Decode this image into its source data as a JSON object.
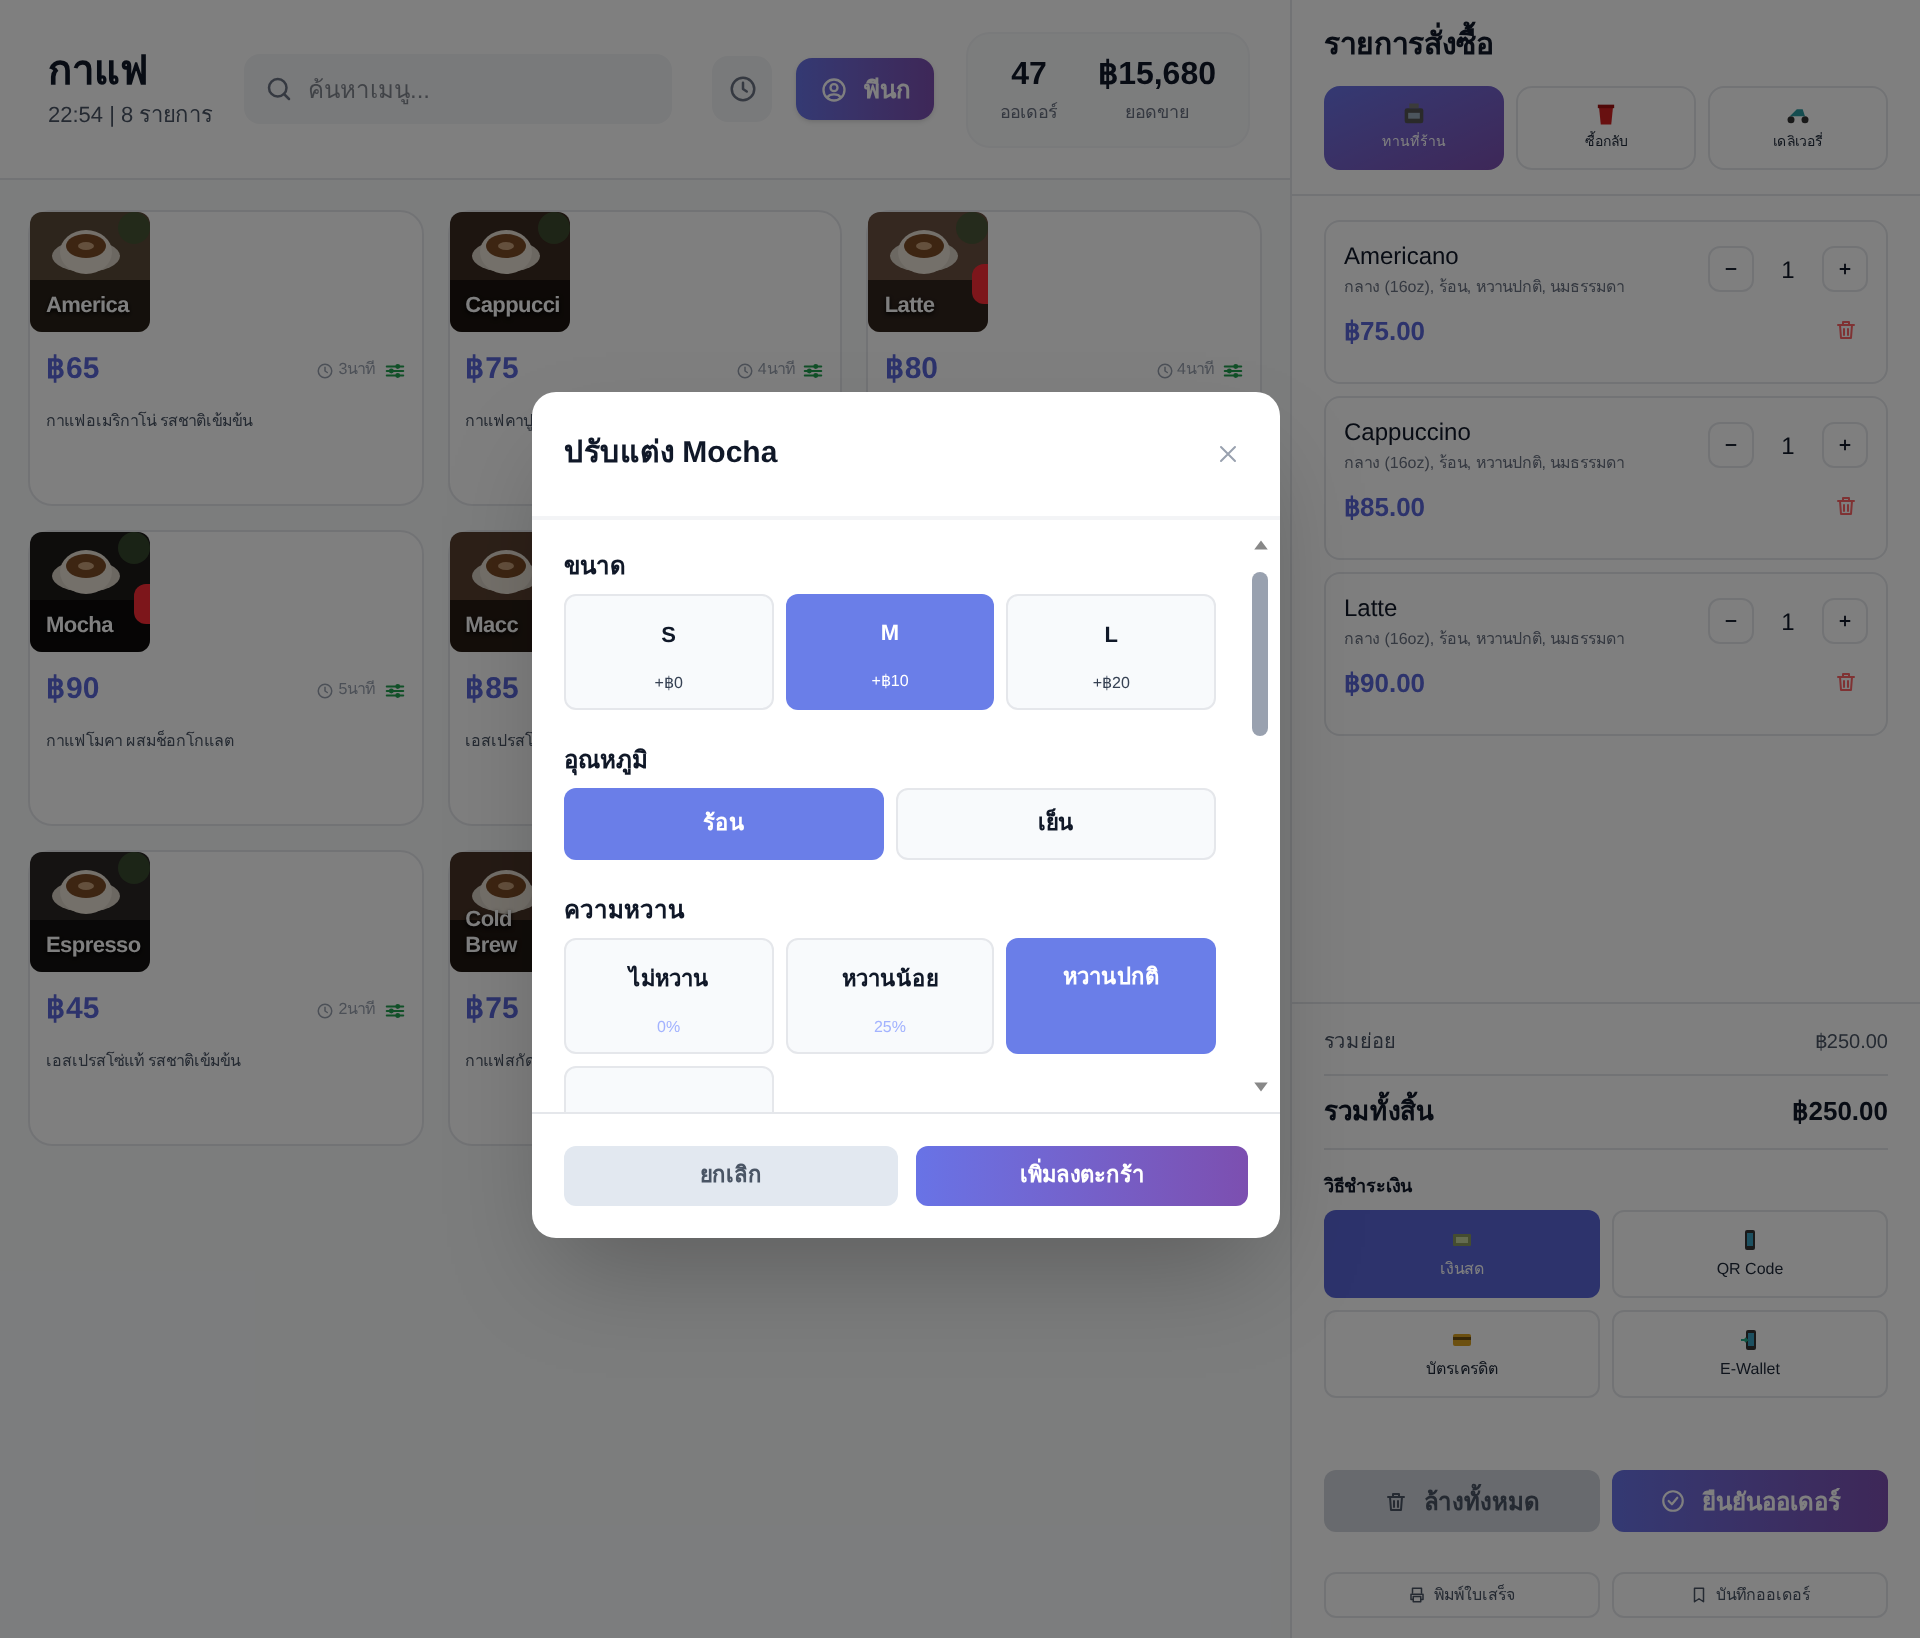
{
  "header": {
    "title": "กาแฟ",
    "subtitle": "22:54 | 8 รายการ",
    "search": {
      "placeholder": "ค้นหาเมนู..."
    },
    "staff": "พีนก",
    "stats": [
      {
        "value": "47",
        "label": "ออเดอร์"
      },
      {
        "value": "฿15,680",
        "label": "ยอดขาย"
      }
    ]
  },
  "product_rows": [
    [
      {
        "name": "America",
        "price": "฿65",
        "time": "3นาที",
        "description": "กาแฟอเมริกาโน่ รสชาติเข้มข้น",
        "popular": false
      },
      {
        "name": "Cappucci",
        "price": "฿75",
        "time": "4นาที",
        "description": "กาแฟคาปู",
        "popular": false
      },
      {
        "name": "Latte",
        "price": "฿80",
        "time": "4นาที",
        "popular": true
      }
    ],
    [
      {
        "name": "Mocha",
        "price": "฿90",
        "time": "5นาที",
        "description": "กาแฟโมคา ผสมช็อกโกแลต",
        "popular": true
      },
      {
        "name": "Macc",
        "price": "฿85",
        "description": "เอสเปรสโ",
        "popular": false
      }
    ],
    [
      {
        "name": "Espresso",
        "price": "฿45",
        "time": "2นาที",
        "description": "เอสเปรสโซ่แท้ รสชาติเข้มข้น",
        "popular": false
      },
      {
        "name": "Cold Brew",
        "price": "฿75",
        "description": "กาแฟสกัด",
        "popular": false
      }
    ]
  ],
  "modal": {
    "title": "ปรับแต่ง Mocha",
    "sections": [
      {
        "label": "ขนาด",
        "options": [
          {
            "label": "S",
            "sub": "+฿0",
            "selected": false
          },
          {
            "label": "M",
            "sub": "+฿10",
            "selected": true
          },
          {
            "label": "L",
            "sub": "+฿20",
            "selected": false
          }
        ]
      },
      {
        "label": "อุณหภูมิ",
        "options": [
          {
            "label": "ร้อน",
            "selected": true
          },
          {
            "label": "เย็น",
            "selected": false
          }
        ]
      },
      {
        "label": "ความหวาน",
        "options": [
          {
            "label": "ไม่หวาน",
            "sub": "0%",
            "selected": false
          },
          {
            "label": "หวานน้อย",
            "sub": "25%",
            "selected": false
          },
          {
            "label": "หวานปกติ",
            "selected": true
          },
          {
            "selected": false
          }
        ]
      }
    ],
    "buttons": [
      {
        "kind": "cancel",
        "label": "ยกเลิก"
      },
      {
        "kind": "primary",
        "label": "เพิ่มลงตะกร้า"
      }
    ]
  },
  "order": {
    "title": "รายการสั่งซื้อ",
    "types": [
      {
        "kind": "dinein",
        "label": "ทานที่ร้าน",
        "selected": true
      },
      {
        "kind": "takeaway",
        "label": "ซื้อกลับ",
        "selected": false
      },
      {
        "kind": "delivery",
        "label": "เดลิเวอรี่",
        "selected": false
      }
    ],
    "items": [
      {
        "name": "Americano",
        "options": "กลาง (16oz), ร้อน, หวานปกติ, นมธรรมดา",
        "quantity": "1",
        "price": "฿75.00"
      },
      {
        "name": "Cappuccino",
        "options": "กลาง (16oz), ร้อน, หวานปกติ, นมธรรมดา",
        "quantity": "1",
        "price": "฿85.00"
      },
      {
        "name": "Latte",
        "options": "กลาง (16oz), ร้อน, หวานปกติ, นมธรรมดา",
        "quantity": "1",
        "price": "฿90.00"
      }
    ],
    "subtotal": {
      "label": "รวมย่อย",
      "value": "฿250.00"
    },
    "total": {
      "label": "รวมทั้งสิ้น",
      "value": "฿250.00"
    },
    "payment_label": "วิธีชำระเงิน",
    "payments": [
      {
        "kind": "cash",
        "label": "เงินสด",
        "selected": true
      },
      {
        "kind": "qr",
        "label": "QR Code",
        "selected": false
      },
      {
        "kind": "card",
        "label": "บัตรเครดิต",
        "selected": false
      },
      {
        "kind": "wallet",
        "label": "E-Wallet",
        "selected": false
      }
    ],
    "actions": [
      {
        "kind": "clear",
        "label": "ล้างทั้งหมด"
      },
      {
        "kind": "confirm",
        "label": "ยืนยันออเดอร์"
      }
    ],
    "secondary": [
      {
        "kind": "print",
        "label": "พิมพ์ใบเสร็จ"
      },
      {
        "kind": "save",
        "label": "บันทึกออเดอร์"
      }
    ]
  }
}
